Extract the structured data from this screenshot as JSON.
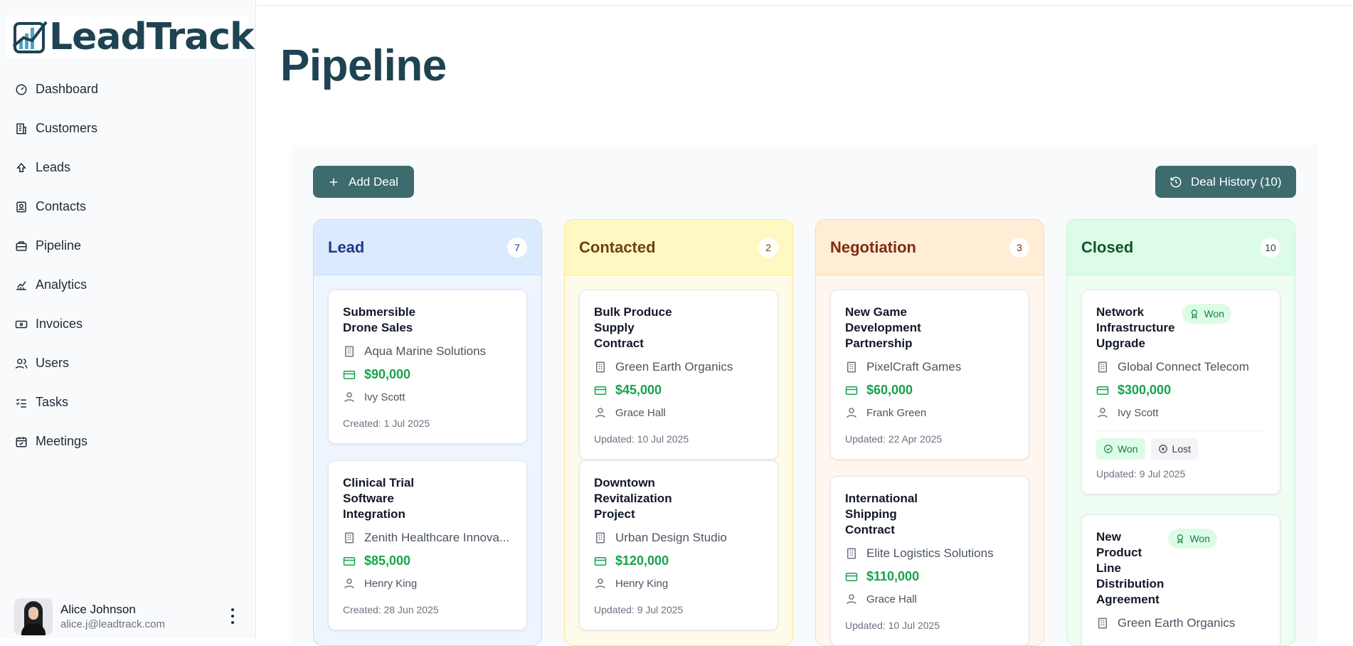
{
  "app": {
    "logo_text": "LeadTrack"
  },
  "sidebar": {
    "items": [
      {
        "label": "Dashboard",
        "icon": "gauge-icon"
      },
      {
        "label": "Customers",
        "icon": "building-icon"
      },
      {
        "label": "Leads",
        "icon": "arrow-up-icon"
      },
      {
        "label": "Contacts",
        "icon": "contact-card-icon"
      },
      {
        "label": "Pipeline",
        "icon": "briefcase-icon"
      },
      {
        "label": "Analytics",
        "icon": "chart-line-icon"
      },
      {
        "label": "Invoices",
        "icon": "banknote-icon"
      },
      {
        "label": "Users",
        "icon": "users-icon"
      },
      {
        "label": "Tasks",
        "icon": "list-checks-icon"
      },
      {
        "label": "Meetings",
        "icon": "calendar-check-icon"
      }
    ]
  },
  "user": {
    "name": "Alice Johnson",
    "email": "alice.j@leadtrack.com"
  },
  "page": {
    "title": "Pipeline"
  },
  "toolbar": {
    "add_label": "Add Deal",
    "history_label": "Deal History (10)"
  },
  "columns": [
    {
      "title": "Lead",
      "count": "7",
      "colors": {
        "bg": "#eef5ff",
        "head": "#dbeafe",
        "border": "#bfdbfe",
        "title": "#1e3a8a"
      },
      "cards": [
        {
          "title": "Submersible Drone Sales",
          "company": "Aqua Marine Solutions",
          "amount": "$90,000",
          "person": "Ivy Scott",
          "meta": "Created: 1 Jul 2025"
        },
        {
          "title": "Clinical Trial Software Integration",
          "company": "Zenith Healthcare Innova...",
          "amount": "$85,000",
          "person": "Henry King",
          "meta": "Created: 28 Jun 2025"
        }
      ]
    },
    {
      "title": "Contacted",
      "count": "2",
      "colors": {
        "bg": "#fffbea",
        "head": "#fef9c3",
        "border": "#fde68a",
        "title": "#713f12"
      },
      "cards": [
        {
          "title": "Bulk Produce Supply Contract",
          "company": "Green Earth Organics",
          "amount": "$45,000",
          "person": "Grace Hall",
          "meta": "Updated: 10 Jul 2025"
        },
        {
          "title": "Downtown Revitalization Project",
          "company": "Urban Design Studio",
          "amount": "$120,000",
          "person": "Henry King",
          "meta": "Updated: 9 Jul 2025"
        }
      ]
    },
    {
      "title": "Negotiation",
      "count": "3",
      "colors": {
        "bg": "#fff7ef",
        "head": "#ffedd5",
        "border": "#fed7aa",
        "title": "#7c2d12"
      },
      "cards": [
        {
          "title": "New Game Development Partnership",
          "company": "PixelCraft Games",
          "amount": "$60,000",
          "person": "Frank Green",
          "meta": "Updated: 22 Apr 2025"
        },
        {
          "title": "International Shipping Contract",
          "company": "Elite Logistics Solutions",
          "amount": "$110,000",
          "person": "Grace Hall",
          "meta": "Updated: 10 Jul 2025"
        }
      ]
    },
    {
      "title": "Closed",
      "count": "10",
      "colors": {
        "bg": "#effdf3",
        "head": "#dcfce7",
        "border": "#bbf7d0",
        "title": "#14532d"
      },
      "cards": [
        {
          "title": "Network Infrastructure Upgrade",
          "badge": "Won",
          "company": "Global Connect Telecom",
          "amount": "$300,000",
          "person": "Ivy Scott",
          "won_label": "Won",
          "lost_label": "Lost",
          "meta": "Updated: 9 Jul 2025"
        },
        {
          "title": "New Product Line Distribution Agreement",
          "badge": "Won",
          "company": "Green Earth Organics"
        }
      ]
    }
  ]
}
